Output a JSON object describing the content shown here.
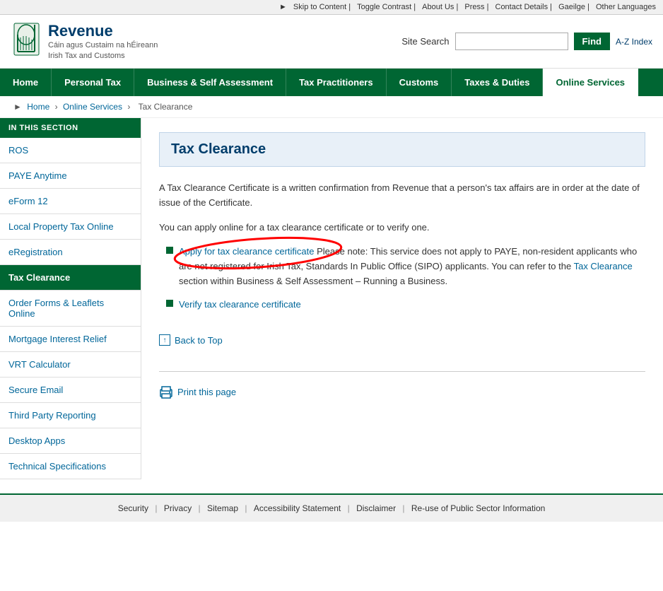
{
  "topbar": {
    "links": [
      {
        "id": "skip-content",
        "label": "Skip to Content"
      },
      {
        "id": "toggle-contrast",
        "label": "Toggle Contrast"
      },
      {
        "id": "about-us",
        "label": "About Us"
      },
      {
        "id": "press",
        "label": "Press"
      },
      {
        "id": "contact-details",
        "label": "Contact Details"
      },
      {
        "id": "gaeilge",
        "label": "Gaeilge"
      },
      {
        "id": "other-languages",
        "label": "Other Languages"
      }
    ]
  },
  "header": {
    "logo_line1": "Revenue",
    "logo_line2": "Cáin agus Custaim na hÉireann",
    "logo_line3": "Irish Tax and Customs",
    "search_label": "Site Search",
    "search_placeholder": "",
    "find_button": "Find",
    "az_link": "A-Z Index"
  },
  "nav": {
    "items": [
      {
        "id": "home",
        "label": "Home",
        "active": false
      },
      {
        "id": "personal-tax",
        "label": "Personal Tax",
        "active": false
      },
      {
        "id": "business-self-assessment",
        "label": "Business & Self Assessment",
        "active": false
      },
      {
        "id": "tax-practitioners",
        "label": "Tax Practitioners",
        "active": false
      },
      {
        "id": "customs",
        "label": "Customs",
        "active": false
      },
      {
        "id": "taxes-duties",
        "label": "Taxes & Duties",
        "active": false
      },
      {
        "id": "online-services",
        "label": "Online Services",
        "active": true
      }
    ]
  },
  "breadcrumb": {
    "items": [
      {
        "label": "Home",
        "href": "#"
      },
      {
        "label": "Online Services",
        "href": "#"
      },
      {
        "label": "Tax Clearance",
        "href": null
      }
    ]
  },
  "sidebar": {
    "section_title": "IN THIS SECTION",
    "items": [
      {
        "id": "ros",
        "label": "ROS",
        "active": false
      },
      {
        "id": "paye-anytime",
        "label": "PAYE Anytime",
        "active": false
      },
      {
        "id": "eform-12",
        "label": "eForm 12",
        "active": false
      },
      {
        "id": "local-property-tax",
        "label": "Local Property Tax Online",
        "active": false
      },
      {
        "id": "eregistration",
        "label": "eRegistration",
        "active": false
      },
      {
        "id": "tax-clearance",
        "label": "Tax Clearance",
        "active": true
      },
      {
        "id": "order-forms",
        "label": "Order Forms & Leaflets Online",
        "active": false
      },
      {
        "id": "mortgage-interest",
        "label": "Mortgage Interest Relief",
        "active": false
      },
      {
        "id": "vrt-calculator",
        "label": "VRT Calculator",
        "active": false
      },
      {
        "id": "secure-email",
        "label": "Secure Email",
        "active": false
      },
      {
        "id": "third-party-reporting",
        "label": "Third Party Reporting",
        "active": false
      },
      {
        "id": "desktop-apps",
        "label": "Desktop Apps",
        "active": false
      },
      {
        "id": "technical-specifications",
        "label": "Technical Specifications",
        "active": false
      }
    ]
  },
  "main": {
    "page_title": "Tax Clearance",
    "intro_text1": "A Tax Clearance Certificate is a written confirmation from Revenue that a person's tax affairs are in order at the date of issue of the Certificate.",
    "intro_text2": "You can apply online for a tax clearance certificate or to verify one.",
    "apply_link_text": "Apply for tax clearance certificate",
    "apply_note": "Please note: This service does not apply to PAYE, non-resident applicants who are not registered for Irish Tax, Standards In Public Office (SIPO) applicants. You can refer to the ",
    "tax_clearance_link": "Tax Clearance",
    "apply_note_end": " section within Business & Self Assessment – Running a Business.",
    "verify_link_text": "Verify tax clearance certificate",
    "back_to_top": "Back to Top",
    "print_label": "Print this page"
  },
  "footer": {
    "links": [
      {
        "id": "security",
        "label": "Security"
      },
      {
        "id": "privacy",
        "label": "Privacy"
      },
      {
        "id": "sitemap",
        "label": "Sitemap"
      },
      {
        "id": "accessibility",
        "label": "Accessibility Statement"
      },
      {
        "id": "disclaimer",
        "label": "Disclaimer"
      },
      {
        "id": "reuse",
        "label": "Re-use of Public Sector Information"
      }
    ]
  }
}
